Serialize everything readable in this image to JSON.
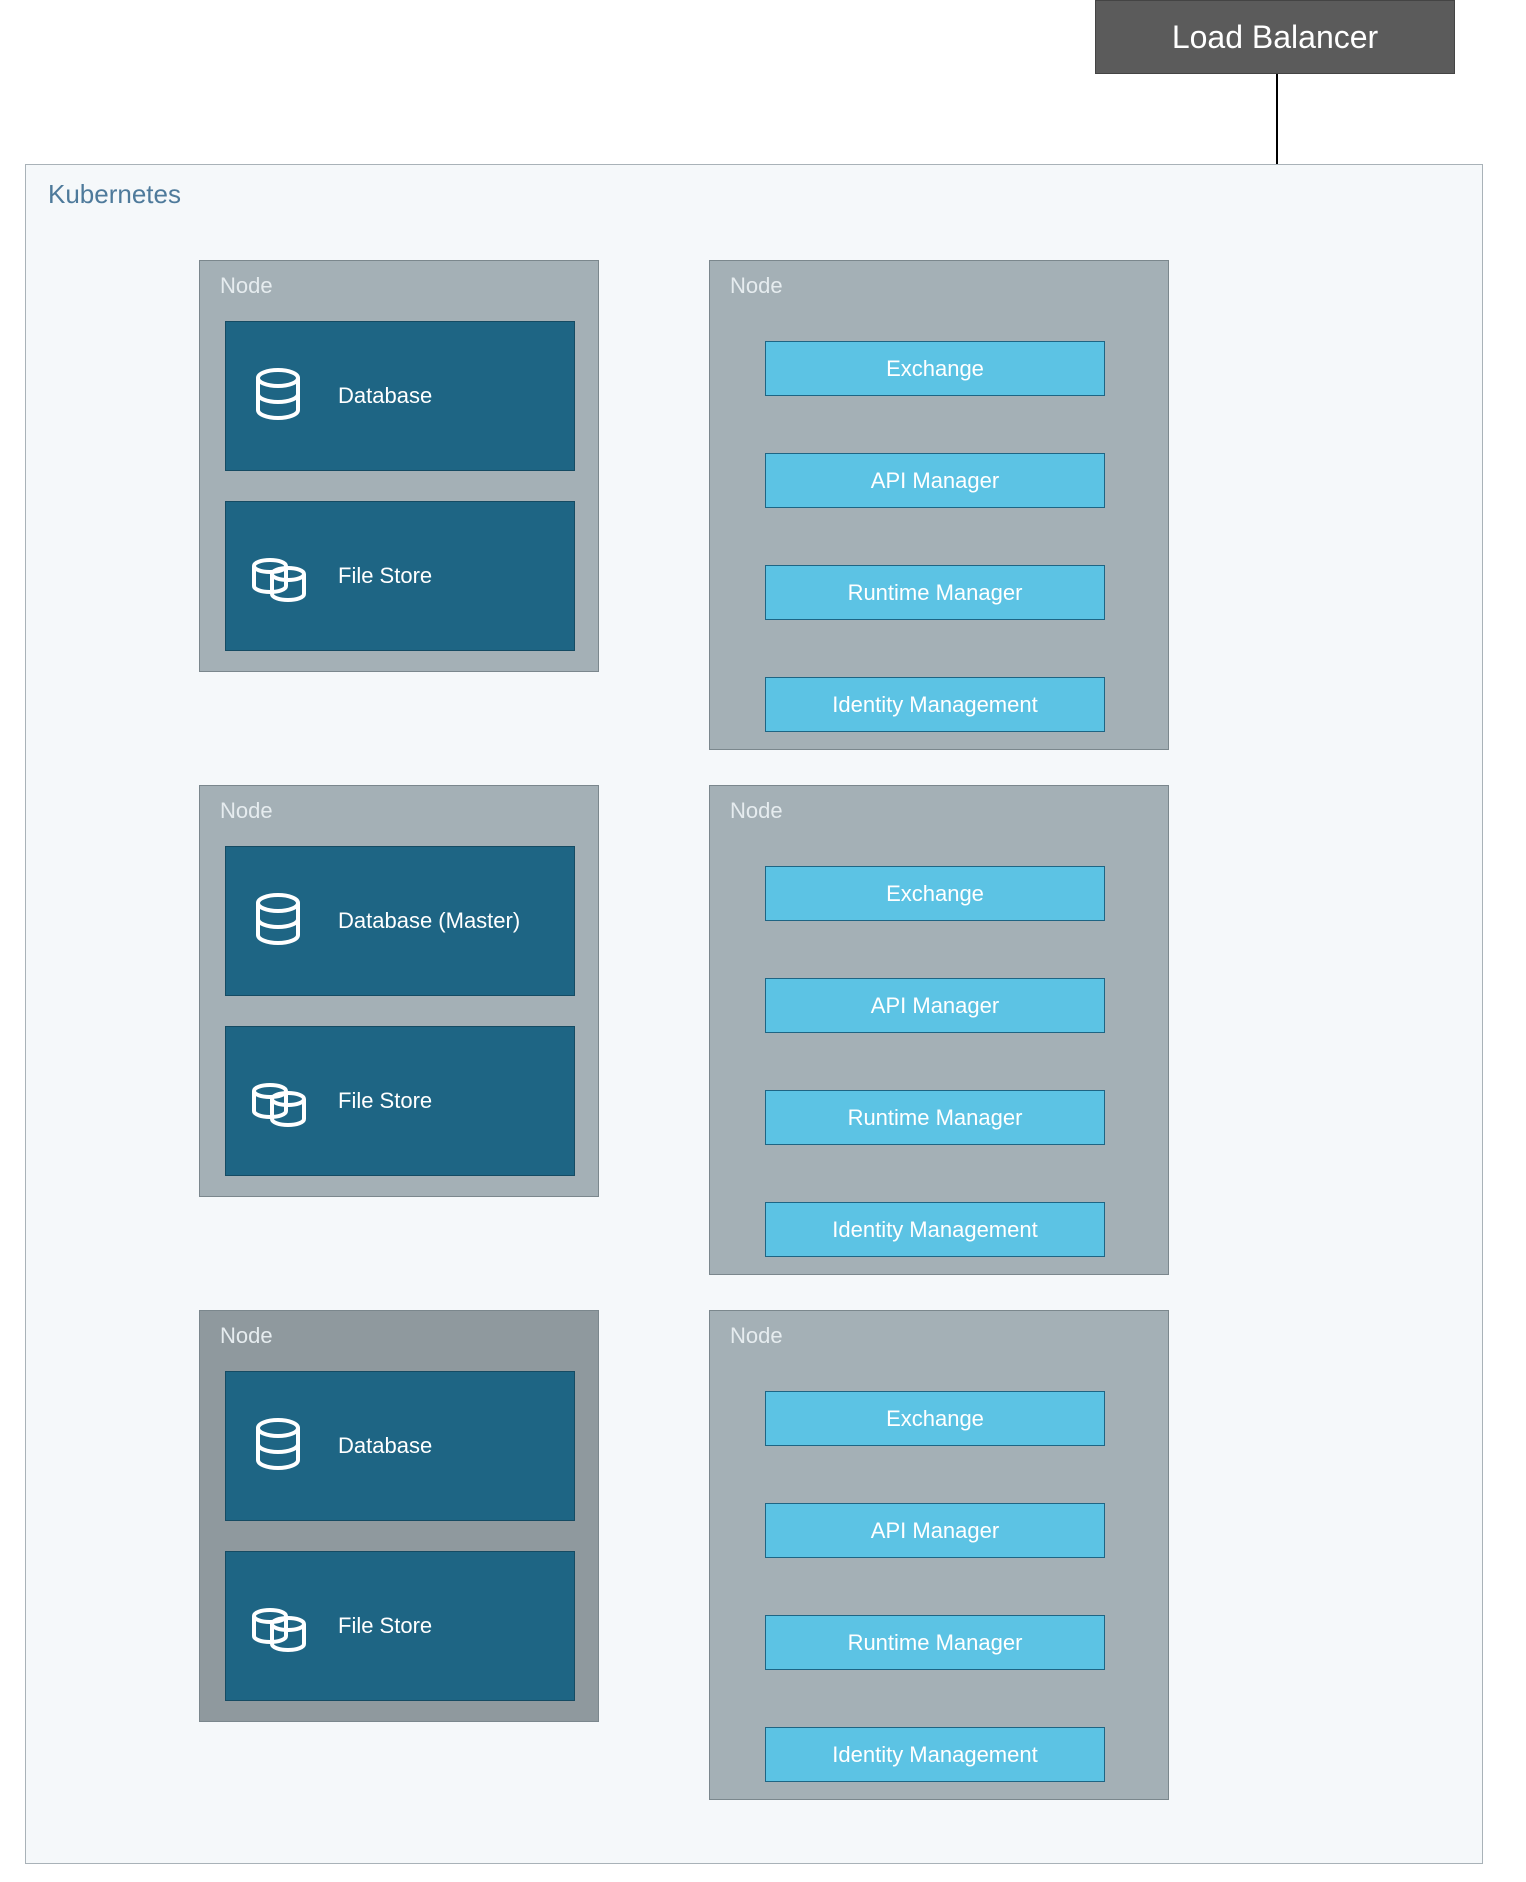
{
  "loadBalancer": {
    "label": "Load Balancer"
  },
  "kubernetes": {
    "label": "Kubernetes"
  },
  "nodeLabel": "Node",
  "leftNodes": [
    {
      "db": "Database",
      "fs": "File Store"
    },
    {
      "db": "Database (Master)",
      "fs": "File Store"
    },
    {
      "db": "Database",
      "fs": "File Store"
    }
  ],
  "rightNodes": [
    {
      "services": [
        "Exchange",
        "API Manager",
        "Runtime Manager",
        "Identity Management"
      ]
    },
    {
      "services": [
        "Exchange",
        "API Manager",
        "Runtime Manager",
        "Identity Management"
      ]
    },
    {
      "services": [
        "Exchange",
        "API Manager",
        "Runtime Manager",
        "Identity Management"
      ]
    }
  ]
}
